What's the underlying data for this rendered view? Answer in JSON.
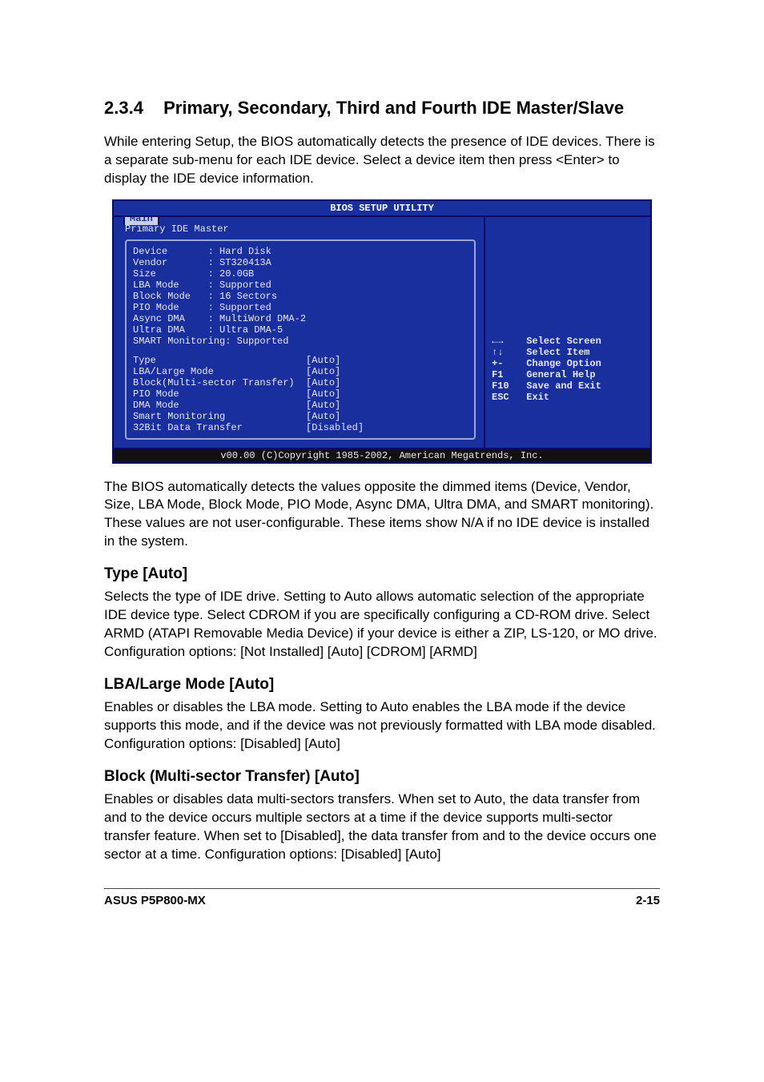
{
  "section": {
    "number": "2.3.4",
    "title": "Primary, Secondary, Third and Fourth IDE Master/Slave"
  },
  "intro": "While entering Setup, the BIOS automatically detects the presence of IDE devices. There is a separate sub-menu for each IDE device. Select a device item then press <Enter> to display the IDE device information.",
  "bios": {
    "utility_title": "BIOS SETUP UTILITY",
    "tab": "Main",
    "screen_title": "Primary IDE Master",
    "info": [
      {
        "label": "Device",
        "value": "Hard Disk"
      },
      {
        "label": "Vendor",
        "value": "ST320413A"
      },
      {
        "label": "Size",
        "value": "20.0GB"
      },
      {
        "label": "LBA Mode",
        "value": "Supported"
      },
      {
        "label": "Block Mode",
        "value": "16 Sectors"
      },
      {
        "label": "PIO Mode",
        "value": "Supported"
      },
      {
        "label": "Async DMA",
        "value": "MultiWord DMA-2"
      },
      {
        "label": "Ultra DMA",
        "value": "Ultra DMA-5"
      },
      {
        "label": "SMART Monitoring",
        "value": "Supported"
      }
    ],
    "options": [
      {
        "label": "Type",
        "value": "[Auto]"
      },
      {
        "label": "LBA/Large Mode",
        "value": "[Auto]"
      },
      {
        "label": "Block(Multi-sector Transfer)",
        "value": "[Auto]"
      },
      {
        "label": "PIO Mode",
        "value": "[Auto]"
      },
      {
        "label": "DMA Mode",
        "value": "[Auto]"
      },
      {
        "label": "Smart Monitoring",
        "value": "[Auto]"
      },
      {
        "label": "32Bit Data Transfer",
        "value": "[Disabled]"
      }
    ],
    "help": [
      {
        "key": "←→",
        "desc": "Select Screen"
      },
      {
        "key": "↑↓",
        "desc": "Select Item"
      },
      {
        "key": "+-",
        "desc": "Change Option"
      },
      {
        "key": "F1",
        "desc": "General Help"
      },
      {
        "key": "F10",
        "desc": "Save and Exit"
      },
      {
        "key": "ESC",
        "desc": "Exit"
      }
    ],
    "footer": "v00.00 (C)Copyright 1985-2002, American Megatrends, Inc."
  },
  "after_bios": "The BIOS automatically detects the values opposite the dimmed items (Device, Vendor, Size, LBA Mode, Block Mode, PIO Mode, Async DMA, Ultra DMA, and SMART monitoring). These values are not user-configurable. These items show N/A if no IDE device is installed in the system.",
  "type_section": {
    "heading": "Type [Auto]",
    "body": "Selects the type of IDE drive. Setting to Auto allows automatic selection of the appropriate IDE device type. Select CDROM if you are specifically configuring a CD-ROM drive. Select ARMD (ATAPI Removable Media Device) if your device is either a ZIP, LS-120, or MO drive. Configuration options: [Not Installed] [Auto] [CDROM] [ARMD]"
  },
  "lba_section": {
    "heading": "LBA/Large Mode [Auto]",
    "body": "Enables or disables the LBA mode. Setting to Auto enables the LBA mode if the device supports this mode, and if the device was not previously formatted with LBA mode disabled. Configuration options: [Disabled] [Auto]"
  },
  "block_section": {
    "heading": "Block (Multi-sector Transfer) [Auto]",
    "body": "Enables or disables data multi-sectors transfers. When set to Auto, the data transfer from and to the device occurs multiple sectors at a time if the device supports multi-sector transfer feature. When set to [Disabled], the data transfer from and to the device occurs one sector at a time. Configuration options: [Disabled] [Auto]"
  },
  "footer": {
    "left": "ASUS P5P800-MX",
    "right": "2-15"
  }
}
